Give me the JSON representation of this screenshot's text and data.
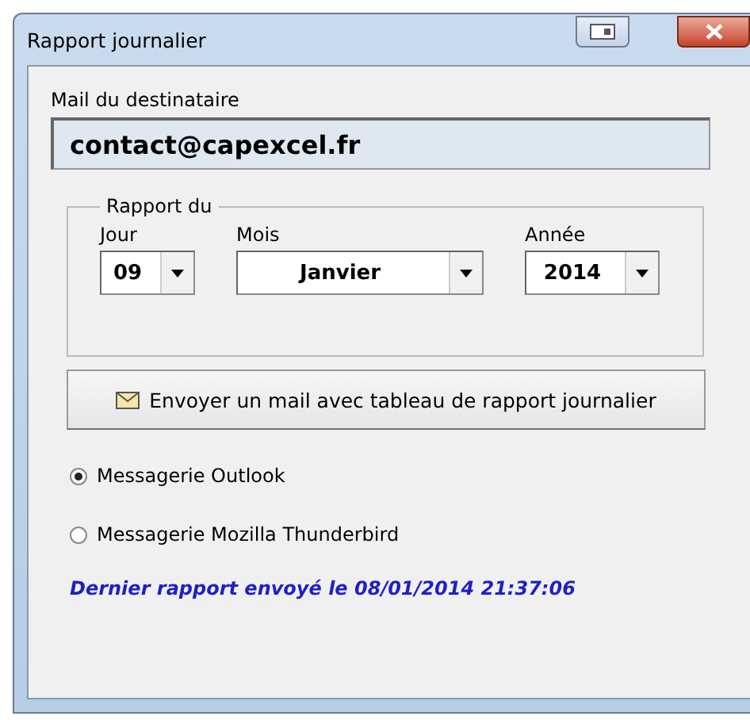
{
  "window": {
    "title": "Rapport journalier"
  },
  "recipient": {
    "label": "Mail du destinataire",
    "value": "contact@capexcel.fr"
  },
  "report_date": {
    "legend": "Rapport du",
    "fields": [
      {
        "label": "Jour",
        "value": "09"
      },
      {
        "label": "Mois",
        "value": "Janvier"
      },
      {
        "label": "Année",
        "value": "2014"
      }
    ]
  },
  "send_button": {
    "label": "Envoyer un mail avec tableau de rapport journalier"
  },
  "mail_clients": [
    {
      "label": "Messagerie Outlook",
      "selected": true
    },
    {
      "label": "Messagerie Mozilla Thunderbird",
      "selected": false
    }
  ],
  "status": "Dernier rapport envoyé le 08/01/2014 21:37:06"
}
